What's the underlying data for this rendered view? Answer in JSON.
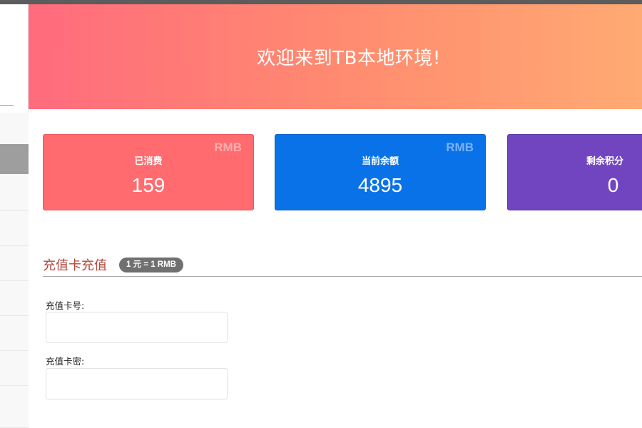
{
  "banner": {
    "welcome_text": "欢迎来到TB本地环境!"
  },
  "stats": [
    {
      "label": "已消费",
      "value": "159",
      "unit": "RMB",
      "color": "#ff6b6e"
    },
    {
      "label": "当前余额",
      "value": "4895",
      "unit": "RMB",
      "color": "#0a72e8"
    },
    {
      "label": "剩余积分",
      "value": "0",
      "color": "#7245c0"
    }
  ],
  "recharge": {
    "title": "充值卡充值",
    "rate_badge": "1 元 = 1 RMB",
    "card_number": {
      "label": "充值卡号:",
      "value": "",
      "placeholder": ""
    },
    "card_password": {
      "label": "充值卡密:",
      "value": "",
      "placeholder": ""
    }
  },
  "colors": {
    "section_title": "#b4473b",
    "banner_start": "#ff6b7d",
    "banner_end": "#ffaa72"
  }
}
